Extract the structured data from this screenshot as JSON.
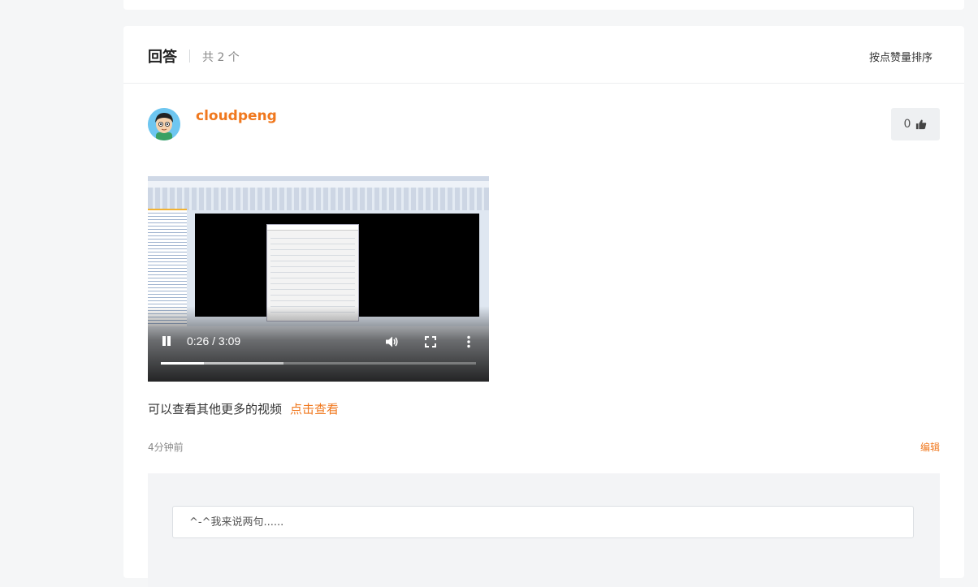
{
  "answers": {
    "title": "回答",
    "count": "共 2 个",
    "sort_label": "按点赞量排序"
  },
  "answer": {
    "username": "cloudpeng",
    "likes": "0",
    "video": {
      "time": "0:26 / 3:09",
      "played_fraction": 0.1376,
      "buffered_fraction": 0.39
    },
    "text": "可以查看其他更多的视频",
    "link_text": "点击查看",
    "time_ago": "4分钟前",
    "edit_label": "编辑"
  },
  "comment": {
    "placeholder": "^-^我来说两句......"
  },
  "colors": {
    "accent": "#f0781e",
    "background": "#f5f6f7"
  }
}
